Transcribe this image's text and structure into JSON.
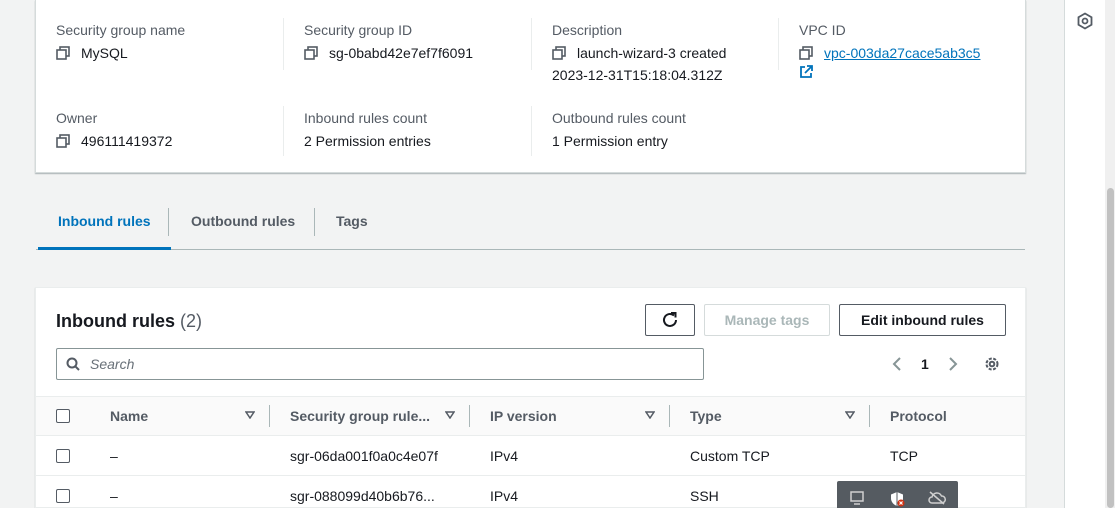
{
  "details": {
    "sg_name_label": "Security group name",
    "sg_name_value": "MySQL",
    "sg_id_label": "Security group ID",
    "sg_id_value": "sg-0babd42e7ef7f6091",
    "description_label": "Description",
    "description_line1": "launch-wizard-3 created",
    "description_line2": "2023-12-31T15:18:04.312Z",
    "vpc_label": "VPC ID",
    "vpc_value": "vpc-003da27cace5ab3c5",
    "owner_label": "Owner",
    "owner_value": "496111419372",
    "inbound_count_label": "Inbound rules count",
    "inbound_count_value": "2 Permission entries",
    "outbound_count_label": "Outbound rules count",
    "outbound_count_value": "1 Permission entry"
  },
  "tabs": [
    {
      "label": "Inbound rules",
      "active": true
    },
    {
      "label": "Outbound rules",
      "active": false
    },
    {
      "label": "Tags",
      "active": false
    }
  ],
  "panel": {
    "title": "Inbound rules",
    "count": "(2)",
    "manage_tags_label": "Manage tags",
    "edit_label": "Edit inbound rules",
    "search_placeholder": "Search",
    "page": "1"
  },
  "table": {
    "columns": [
      "Name",
      "Security group rule...",
      "IP version",
      "Type",
      "Protocol"
    ],
    "rows": [
      {
        "name": "–",
        "rule_id": "sgr-06da001f0a0c4e07f",
        "ip_version": "IPv4",
        "type": "Custom TCP",
        "protocol": "TCP"
      },
      {
        "name": "–",
        "rule_id": "sgr-088099d40b6b76...",
        "ip_version": "IPv4",
        "type": "SSH",
        "protocol": ""
      }
    ]
  },
  "colors": {
    "accent": "#0073bb",
    "text": "#16191f",
    "muted": "#545b64",
    "background": "#f2f3f3"
  }
}
